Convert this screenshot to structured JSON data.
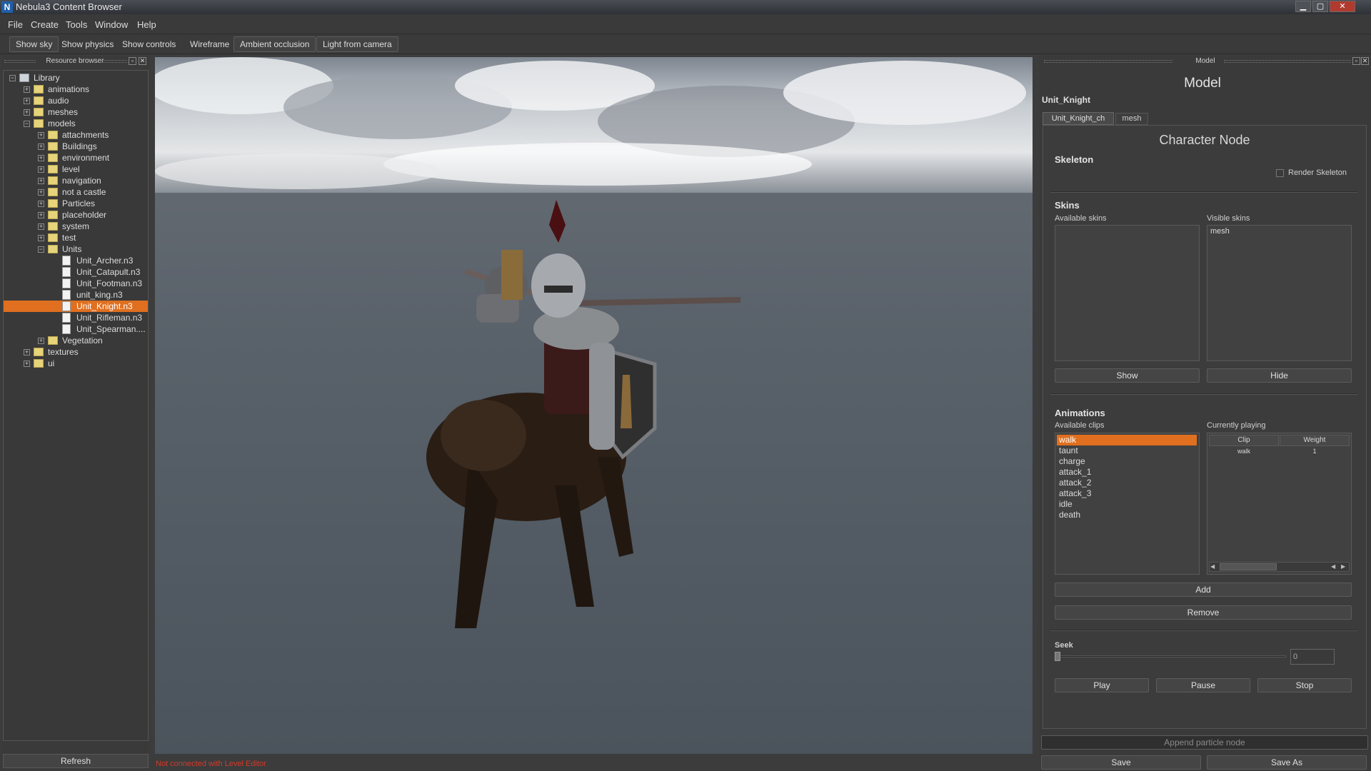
{
  "window": {
    "app_icon": "N",
    "title": "Nebula3 Content Browser",
    "minimize": "▁",
    "maximize": "▢",
    "close": "✕"
  },
  "menu": [
    "File",
    "Create",
    "Tools",
    "Window",
    "Help"
  ],
  "toolbar": [
    {
      "label": "Show sky",
      "active": true
    },
    {
      "label": "Show physics",
      "active": false
    },
    {
      "label": "Show controls",
      "active": false
    },
    {
      "label": "Wireframe",
      "active": false
    },
    {
      "label": "Ambient occlusion",
      "active": true
    },
    {
      "label": "Light from camera",
      "active": true
    }
  ],
  "resource_browser": {
    "title": "Resource browser",
    "refresh": "Refresh",
    "tree": [
      {
        "label": "Library",
        "depth": 0,
        "kind": "root",
        "expander": "−"
      },
      {
        "label": "animations",
        "depth": 1,
        "kind": "folder",
        "expander": "+"
      },
      {
        "label": "audio",
        "depth": 1,
        "kind": "folder",
        "expander": "+"
      },
      {
        "label": "meshes",
        "depth": 1,
        "kind": "folder",
        "expander": "+"
      },
      {
        "label": "models",
        "depth": 1,
        "kind": "folder",
        "expander": "−"
      },
      {
        "label": "attachments",
        "depth": 2,
        "kind": "folder",
        "expander": "+"
      },
      {
        "label": "Buildings",
        "depth": 2,
        "kind": "folder",
        "expander": "+"
      },
      {
        "label": "environment",
        "depth": 2,
        "kind": "folder",
        "expander": "+"
      },
      {
        "label": "level",
        "depth": 2,
        "kind": "folder",
        "expander": "+"
      },
      {
        "label": "navigation",
        "depth": 2,
        "kind": "folder",
        "expander": "+"
      },
      {
        "label": "not a castle",
        "depth": 2,
        "kind": "folder",
        "expander": "+"
      },
      {
        "label": "Particles",
        "depth": 2,
        "kind": "folder",
        "expander": "+"
      },
      {
        "label": "placeholder",
        "depth": 2,
        "kind": "folder",
        "expander": "+"
      },
      {
        "label": "system",
        "depth": 2,
        "kind": "folder",
        "expander": "+"
      },
      {
        "label": "test",
        "depth": 2,
        "kind": "folder",
        "expander": "+"
      },
      {
        "label": "Units",
        "depth": 2,
        "kind": "folder",
        "expander": "−"
      },
      {
        "label": "Unit_Archer.n3",
        "depth": 3,
        "kind": "file",
        "expander": ""
      },
      {
        "label": "Unit_Catapult.n3",
        "depth": 3,
        "kind": "file",
        "expander": ""
      },
      {
        "label": "Unit_Footman.n3",
        "depth": 3,
        "kind": "file",
        "expander": ""
      },
      {
        "label": "unit_king.n3",
        "depth": 3,
        "kind": "file",
        "expander": ""
      },
      {
        "label": "Unit_Knight.n3",
        "depth": 3,
        "kind": "file",
        "expander": "",
        "selected": true
      },
      {
        "label": "Unit_Rifleman.n3",
        "depth": 3,
        "kind": "file",
        "expander": ""
      },
      {
        "label": "Unit_Spearman....",
        "depth": 3,
        "kind": "file",
        "expander": ""
      },
      {
        "label": "Vegetation",
        "depth": 2,
        "kind": "folder",
        "expander": "+"
      },
      {
        "label": "textures",
        "depth": 1,
        "kind": "folder",
        "expander": "+"
      },
      {
        "label": "ui",
        "depth": 1,
        "kind": "folder",
        "expander": "+"
      }
    ]
  },
  "status_text": "Not connected with Level Editor",
  "model_panel": {
    "dock_title": "Model",
    "heading": "Model",
    "model_name": "Unit_Knight",
    "tabs": [
      {
        "label": "Unit_Knight_ch",
        "active": true
      },
      {
        "label": "mesh",
        "active": false
      }
    ],
    "node_heading": "Character Node",
    "skeleton": {
      "heading": "Skeleton",
      "render_label": "Render Skeleton",
      "checked": false
    },
    "skins": {
      "heading": "Skins",
      "available_label": "Available skins",
      "visible_label": "Visible skins",
      "available": [],
      "visible": [
        "mesh"
      ],
      "show": "Show",
      "hide": "Hide"
    },
    "animations": {
      "heading": "Animations",
      "available_label": "Available clips",
      "playing_label": "Currently playing",
      "clips": [
        "walk",
        "taunt",
        "charge",
        "attack_1",
        "attack_2",
        "attack_3",
        "idle",
        "death"
      ],
      "selected_clip": "walk",
      "playing_columns": [
        "Clip",
        "Weight"
      ],
      "playing": [
        {
          "clip": "walk",
          "weight": "1"
        }
      ],
      "add": "Add",
      "remove": "Remove"
    },
    "seek": {
      "label": "Seek",
      "value": "0",
      "position": 0
    },
    "play": "Play",
    "pause": "Pause",
    "stop": "Stop",
    "append_particle": "Append particle node",
    "save": "Save",
    "save_as": "Save As"
  }
}
